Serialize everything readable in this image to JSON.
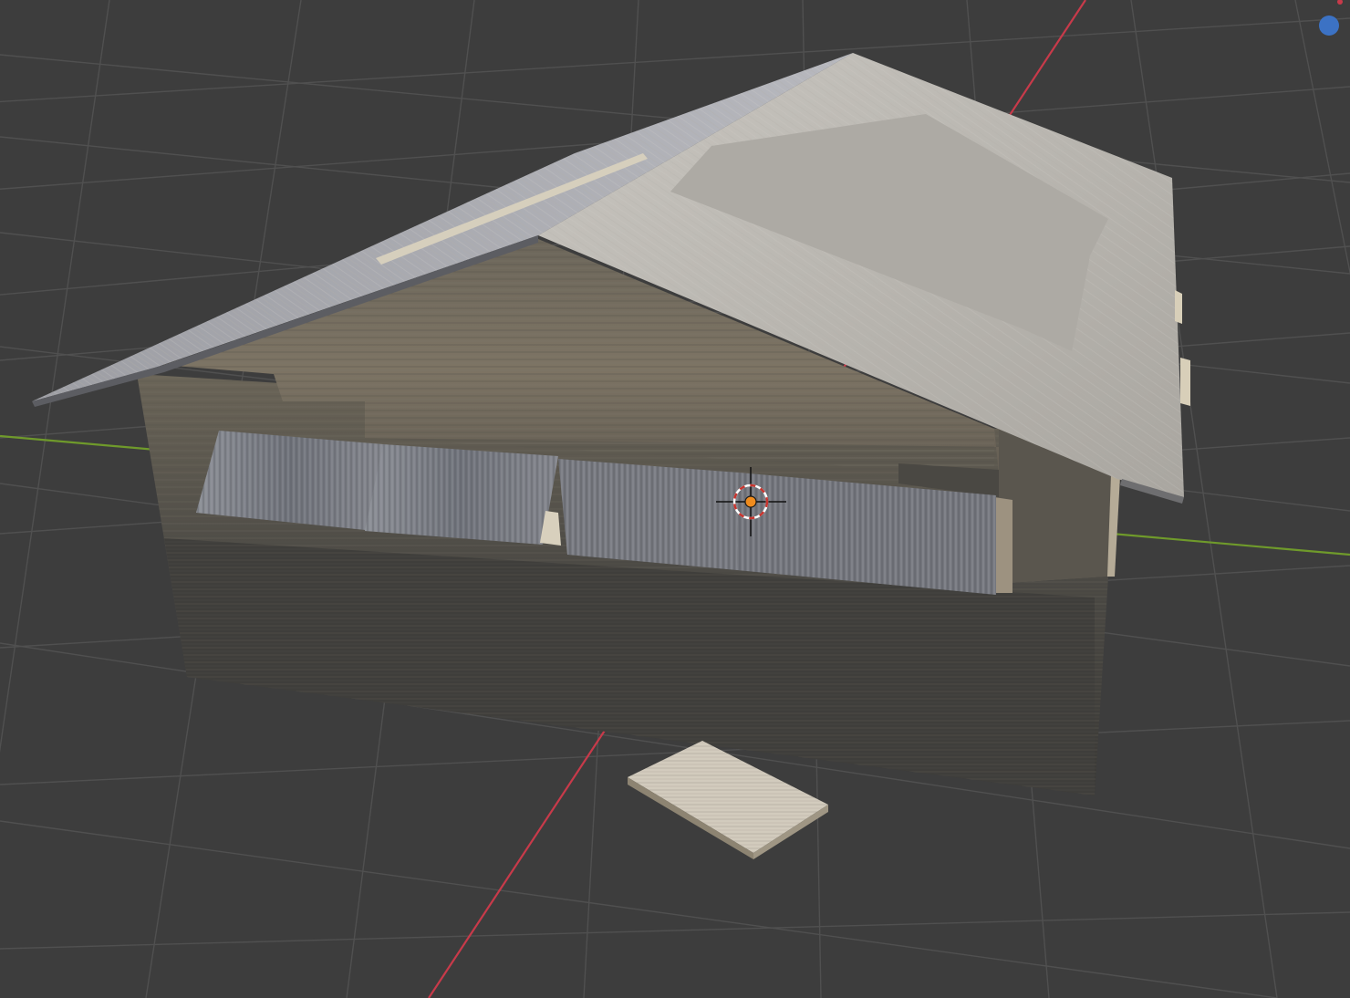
{
  "app": {
    "name": "3D viewport",
    "background_color": "#3d3d3d",
    "grid_color": "#505050",
    "x_axis_color": "#c83a4a",
    "y_axis_color": "#6f9a2b",
    "selection_color": "#f08c1e"
  },
  "viewport": {
    "scene_object": "wooden-shed",
    "loose_object": "wooden-plank",
    "cursor": "3d-cursor",
    "origin": "object-origin",
    "navigation_gizmo": "blue-axis-dot"
  },
  "icons": {
    "cursor_icon": "3d-cursor-icon",
    "gizmo_icon": "navigation-gizmo-icon"
  }
}
